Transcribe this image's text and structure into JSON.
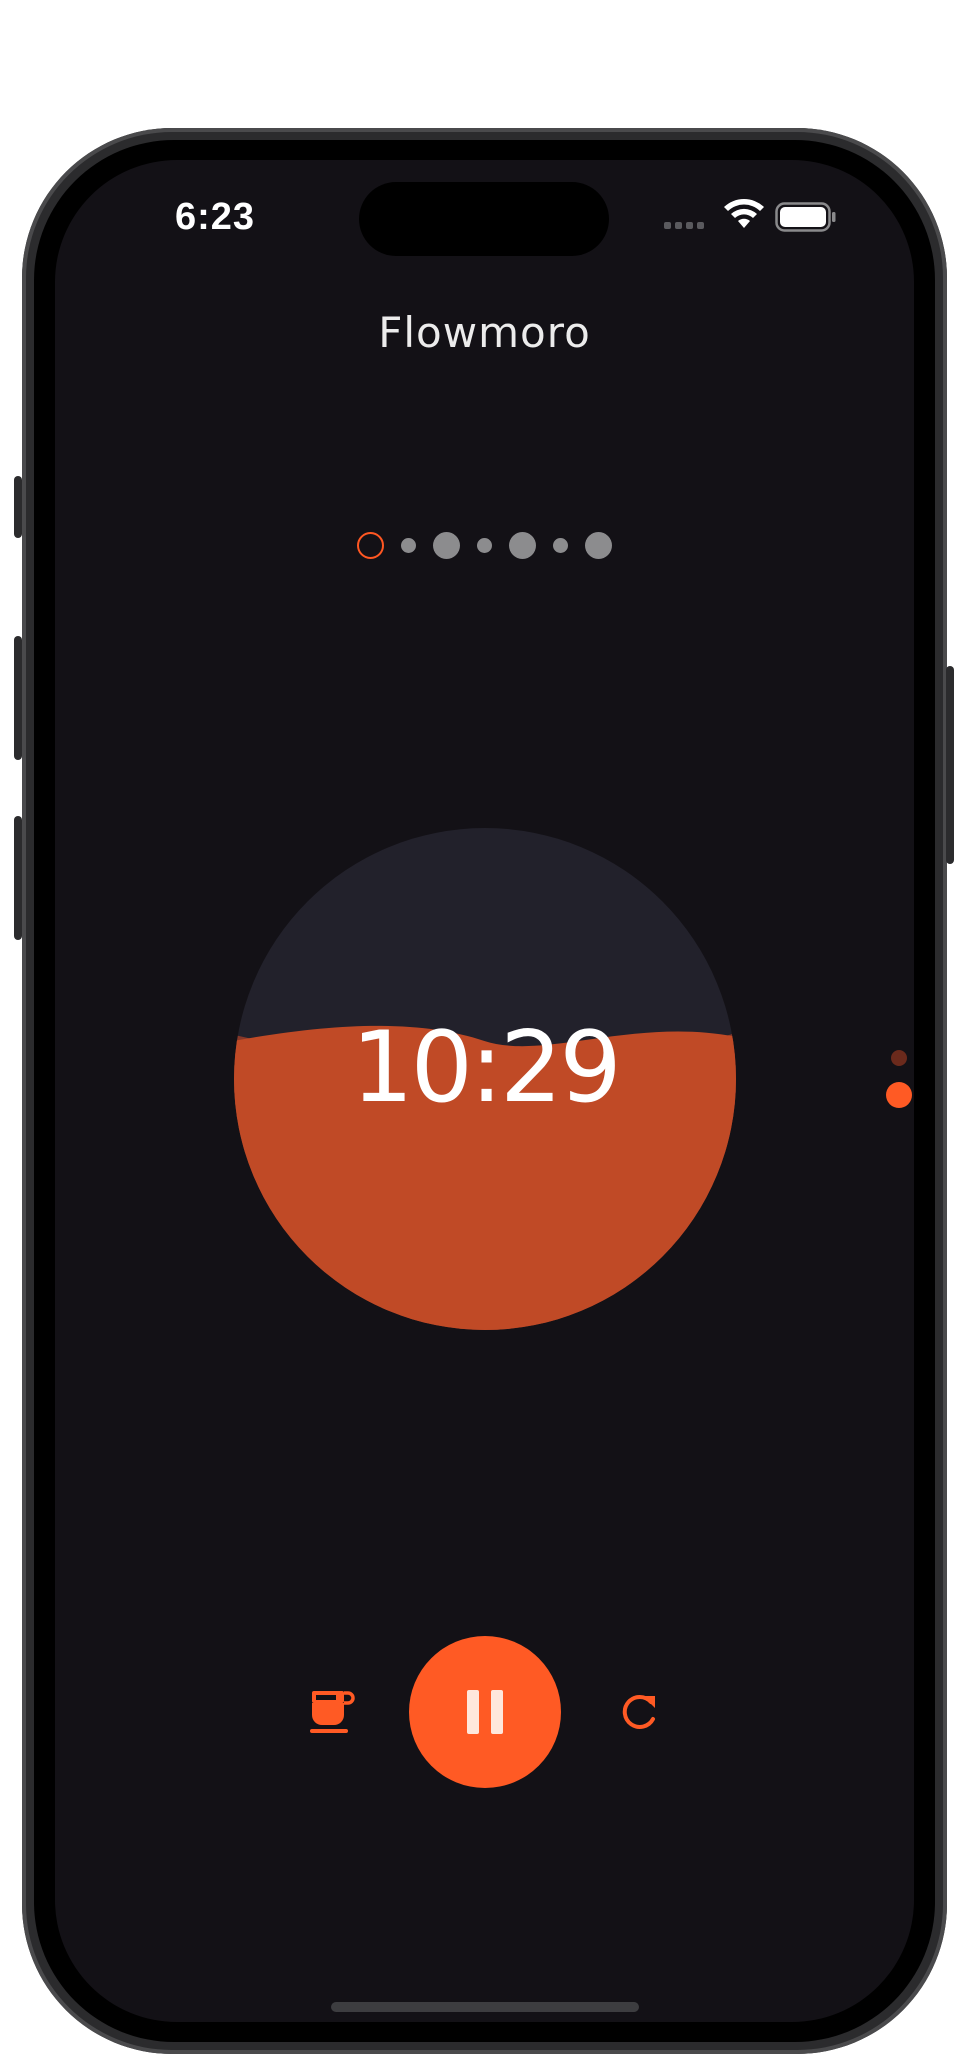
{
  "status_bar": {
    "time": "6:23"
  },
  "app": {
    "title": "Flowmoro"
  },
  "session_dots": [
    {
      "state": "current",
      "kind": "focus"
    },
    {
      "state": "upcoming",
      "kind": "break"
    },
    {
      "state": "upcoming",
      "kind": "focus"
    },
    {
      "state": "upcoming",
      "kind": "break"
    },
    {
      "state": "upcoming",
      "kind": "focus"
    },
    {
      "state": "upcoming",
      "kind": "break"
    },
    {
      "state": "upcoming",
      "kind": "focus"
    }
  ],
  "timer": {
    "display": "10:29",
    "fill_level": 0.58
  },
  "page_indicator": {
    "count": 2,
    "active_index": 1
  },
  "controls": {
    "break_icon": "coffee-cup-icon",
    "primary_icon": "pause-icon",
    "reset_icon": "refresh-icon"
  },
  "colors": {
    "background": "#131116",
    "accent": "#ff5a24",
    "liquid": "#c04a26",
    "circle_top": "#22212b",
    "dot_inactive": "#8c8c8e",
    "title": "#ececec"
  }
}
